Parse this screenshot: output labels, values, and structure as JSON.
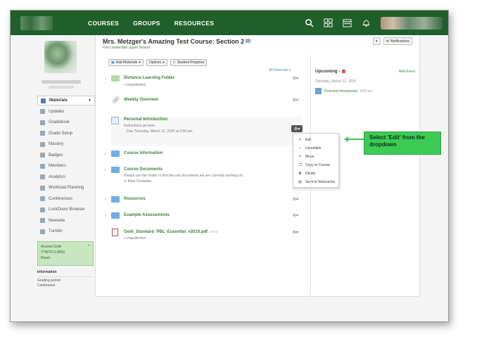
{
  "nav": {
    "links": [
      "COURSES",
      "GROUPS",
      "RESOURCES"
    ]
  },
  "sidebar": {
    "items": [
      {
        "label": "Materials"
      },
      {
        "label": "Updates"
      },
      {
        "label": "Gradebook"
      },
      {
        "label": "Grade Setup"
      },
      {
        "label": "Mastery"
      },
      {
        "label": "Badges"
      },
      {
        "label": "Members"
      },
      {
        "label": "Analytics"
      },
      {
        "label": "Workload Planning"
      },
      {
        "label": "Conferences"
      },
      {
        "label": "LockDown Browser"
      },
      {
        "label": "Newsela"
      },
      {
        "label": "Turnitin"
      }
    ],
    "access": {
      "label": "Access Code",
      "code": "T7W7D-CJH5X",
      "reset": "Reset"
    },
    "info": {
      "label": "Information",
      "line1": "Grading period",
      "line2": "Continuous"
    }
  },
  "course": {
    "title": "Mrs. Metzger's Amazing Test Course: Section 2",
    "school": "Fort Lauderdale Upper School",
    "notifications": "Notifications"
  },
  "toolbar": {
    "add_materials": "Add Materials",
    "options": "Options",
    "student_progress": "Student Progress",
    "all_materials": "All Materials"
  },
  "materials": [
    {
      "name": "Distance Learning Folder",
      "sub": "Unpublished"
    },
    {
      "name": "Weekly Overview",
      "sub": ""
    },
    {
      "name": "Personal Introduction",
      "sub": "Instructions go here.",
      "sub2": "Due Thursday, March 12, 2020 at 3:00 pm"
    },
    {
      "name": "Course Information",
      "sub": ""
    },
    {
      "name": "Course Documents",
      "sub": "Please use this folder to find the unit documents we are currently working on.",
      "sub2": "Must Complete"
    },
    {
      "name": "Resources",
      "sub": ""
    },
    {
      "name": "Example Assessments",
      "sub": ""
    },
    {
      "name": "Gold_Standard_PBL_Essential_v2019.pdf",
      "size": "179 KB",
      "sub": "Unpublished"
    }
  ],
  "dropdown": {
    "items": [
      "Edit",
      "Unpublish",
      "Move",
      "Copy to Course",
      "Delete",
      "Save to Resources"
    ]
  },
  "upcoming": {
    "title": "Upcoming",
    "add_event": "Add Event",
    "date": "Thursday, March 12, 2020",
    "item": "Personal Introduction",
    "time": "3:00 pm"
  },
  "callout": {
    "text": "Select 'Edit' from the dropdown"
  },
  "colors": {
    "nav": "#1f5f2b",
    "link_green": "#3f7d3f",
    "callout": "#3ccb55"
  }
}
